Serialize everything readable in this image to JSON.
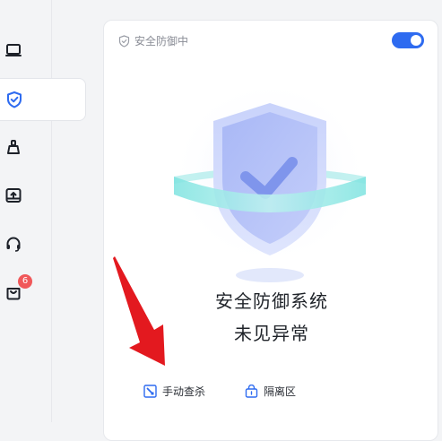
{
  "sidebar": {
    "items": [
      {
        "icon": "laptop-icon"
      },
      {
        "icon": "shield-check-icon",
        "active": true
      },
      {
        "icon": "broom-icon"
      },
      {
        "icon": "drive-upload-icon"
      },
      {
        "icon": "headset-icon"
      },
      {
        "icon": "shopping-bag-icon",
        "badge": "6"
      }
    ]
  },
  "status": {
    "label": "安全防御中",
    "toggle_on": true
  },
  "result": {
    "title": "安全防御系统",
    "subtitle": "未见异常"
  },
  "actions": {
    "manual_scan": "手动查杀",
    "quarantine": "隔离区"
  },
  "colors": {
    "accent": "#2e6bf0",
    "badge": "#f0585a",
    "arrow": "#e3191f"
  }
}
